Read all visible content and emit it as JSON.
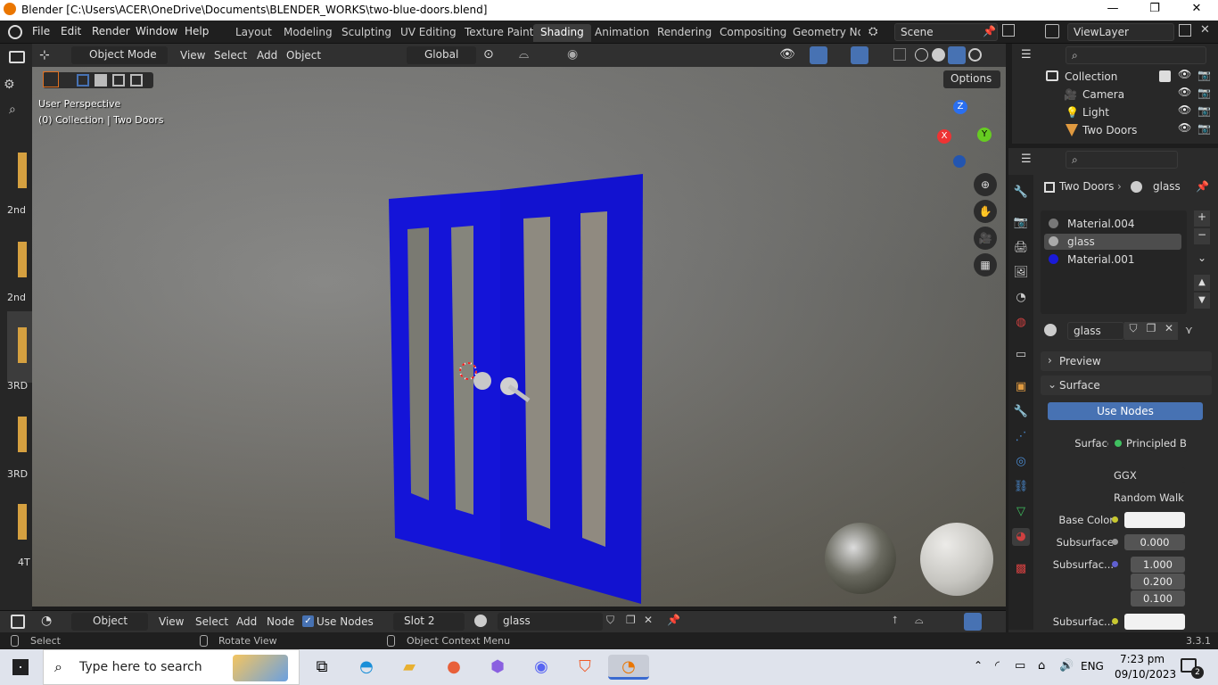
{
  "window": {
    "title": "Blender [C:\\Users\\ACER\\OneDrive\\Documents\\BLENDER_WORKS\\two-blue-doors.blend]",
    "minimize": "—",
    "maximize": "❐",
    "close": "✕"
  },
  "menu": {
    "file": "File",
    "edit": "Edit",
    "render": "Render",
    "window": "Window",
    "help": "Help"
  },
  "workspaces": [
    "Layout",
    "Modeling",
    "Sculpting",
    "UV Editing",
    "Texture Paint",
    "Shading",
    "Animation",
    "Rendering",
    "Compositing",
    "Geometry Noc"
  ],
  "active_workspace": "Shading",
  "scene": {
    "name": "Scene",
    "view_layer": "ViewLayer"
  },
  "toolbar": {
    "mode": "Object Mode",
    "view": "View",
    "select": "Select",
    "add": "Add",
    "object": "Object",
    "orientation": "Global",
    "options": "Options"
  },
  "viewport": {
    "perspective": "User Perspective",
    "collection_info": "(0) Collection | Two Doors",
    "gizmo_x": "X",
    "gizmo_y": "Y",
    "gizmo_z": "Z"
  },
  "left_labels": [
    "2nd",
    "2nd",
    "3RD",
    "3RD",
    "4T"
  ],
  "outliner": {
    "collection": "Collection",
    "items": [
      "Camera",
      "Light",
      "Two Doors"
    ]
  },
  "properties": {
    "breadcrumb_object": "Two Doors",
    "breadcrumb_material": "glass",
    "material_slots": [
      "Material.004",
      "glass",
      "Material.001"
    ],
    "material_name": "glass",
    "preview": "Preview",
    "surface_panel": "Surface",
    "use_nodes": "Use Nodes",
    "surface_label": "Surface",
    "surface_value": "Principled B...",
    "distribution": "GGX",
    "subsurface_method": "Random Walk",
    "base_color_label": "Base Color",
    "subsurface_label": "Subsurface",
    "subsurface_value": "0.000",
    "subsurface_radius_label": "Subsurfac...",
    "radius_values": [
      "1.000",
      "0.200",
      "0.100"
    ],
    "subsurface_color_label": "Subsurfac..."
  },
  "node_editor": {
    "editor": "Object",
    "view": "View",
    "select": "Select",
    "add": "Add",
    "node": "Node",
    "use_nodes": "Use Nodes",
    "slot": "Slot 2",
    "material": "glass"
  },
  "status": {
    "select": "Select",
    "rotate": "Rotate View",
    "context": "Object Context Menu",
    "version": "3.3.1"
  },
  "taskbar": {
    "search_placeholder": "Type here to search",
    "lang": "ENG",
    "time": "7:23 pm",
    "date": "09/10/2023",
    "notif_count": "2"
  },
  "colors": {
    "accent_blue": "#4772b3",
    "door_blue": "#1010d8",
    "active_tab": "#3d3d3d"
  }
}
